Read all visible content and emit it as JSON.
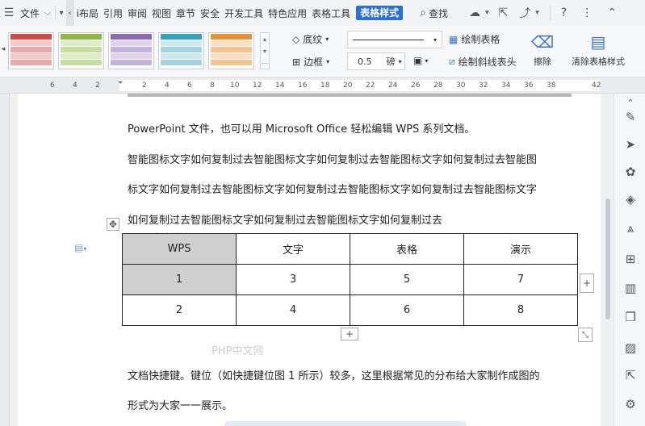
{
  "menubar": {
    "file_label": "文件",
    "tabs": [
      "i布局",
      "引用",
      "审阅",
      "视图",
      "章节",
      "安全",
      "开发工具",
      "特色应用",
      "表格工具"
    ],
    "active_tab": "表格样式",
    "search_label": "查找"
  },
  "ribbon": {
    "shading_label": "底纹",
    "border_label": "边框",
    "line_width_value": "0.5",
    "line_width_unit": "磅",
    "draw_table_label": "绘制表格",
    "draw_diagonal_label": "绘制斜线表头",
    "erase_label": "擦除",
    "clear_style_label": "清除表格样式",
    "swatch_colors": [
      "#c94b4b",
      "#8fb64a",
      "#8a6bb0",
      "#3c9fb8",
      "#e3913a"
    ]
  },
  "ruler": {
    "ticks": [
      "6",
      "4",
      "2",
      "2",
      "4",
      "6",
      "8",
      "10",
      "12",
      "14",
      "16",
      "18",
      "20",
      "22",
      "24",
      "26",
      "28",
      "30",
      "32",
      "34",
      "36",
      "38",
      "42"
    ]
  },
  "document": {
    "line1": "PowerPoint 文件，也可以用 Microsoft Office 轻松编辑 WPS 系列文档。",
    "line2": "智能图标文字如何复制过去智能图标文字如何复制过去智能图标文字如何复制过去智能图",
    "line3": "标文字如何复制过去智能图标文字如何复制过去智能图标文字如何复制过去智能图标文字",
    "line4": "如何复制过去智能图标文字如何复制过去智能图标文字如何复制过去",
    "line5": "文档快捷键。键位（如快捷键位图 1 所示）较多，这里根据常见的分布给大家制作成图的",
    "line6": "形式为大家一一展示。",
    "table": [
      [
        "WPS",
        "文字",
        "表格",
        "演示"
      ],
      [
        "1",
        "3",
        "5",
        "7"
      ],
      [
        "2",
        "4",
        "6",
        "8"
      ]
    ],
    "watermark": "PHP中文网"
  }
}
